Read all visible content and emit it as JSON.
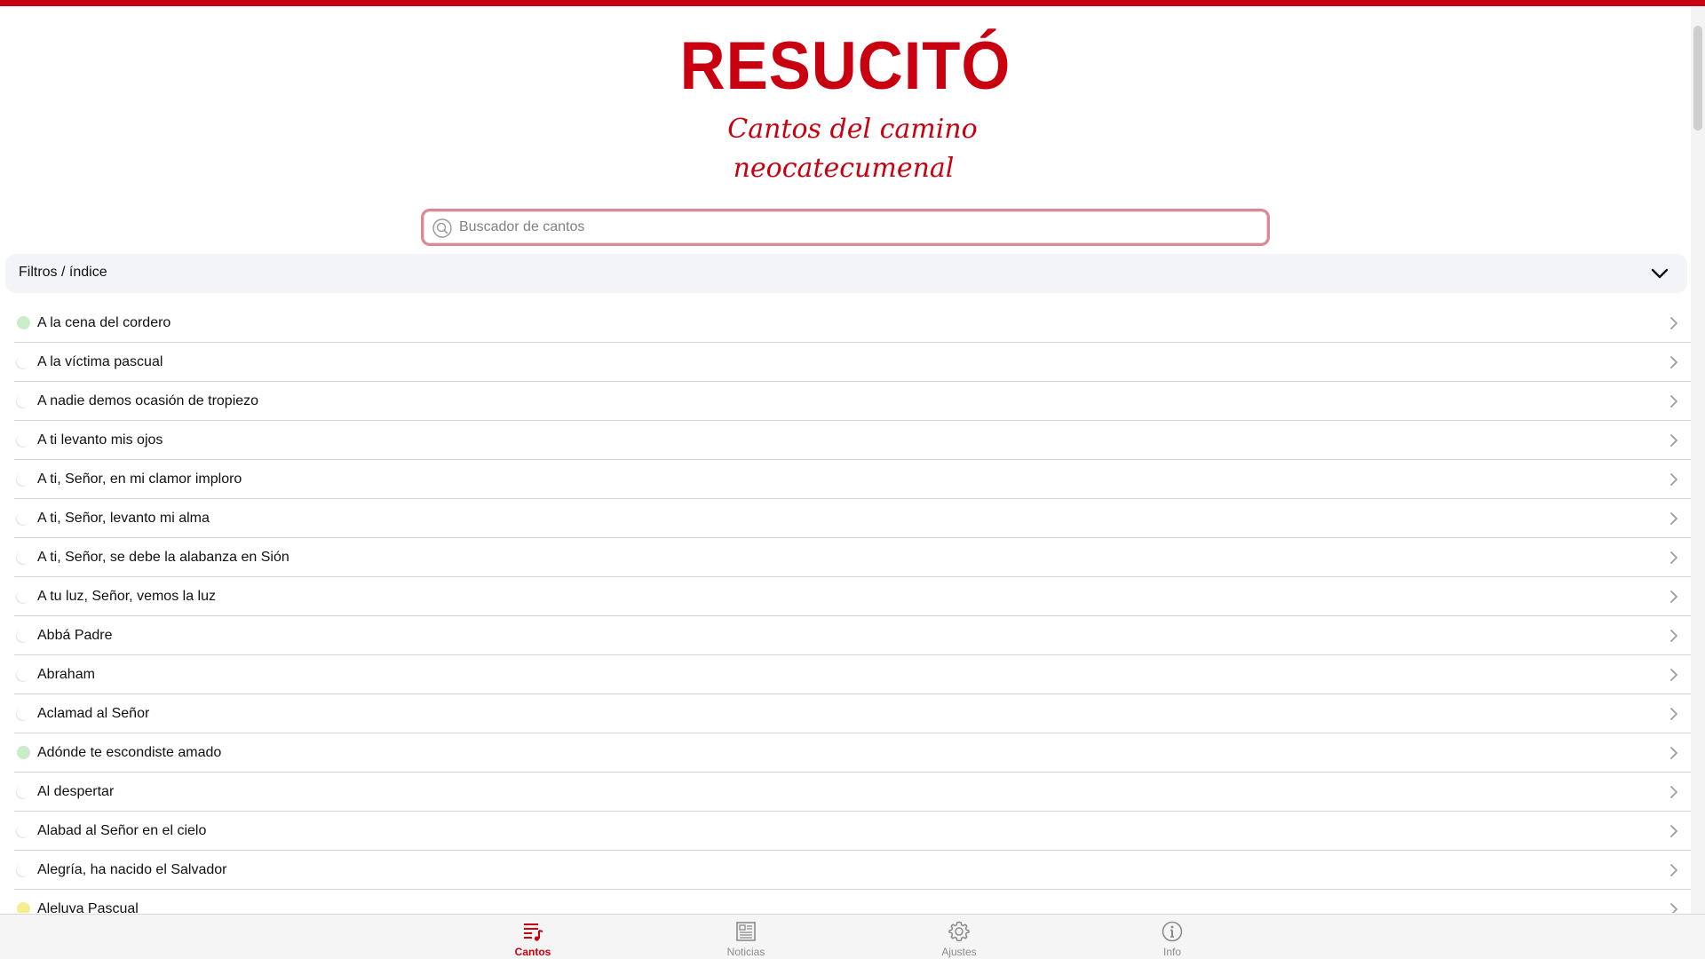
{
  "brand": {
    "title": "RESUCITÓ",
    "subtitle_line1": "Cantos del camino",
    "subtitle_line2": "neocatecumenal",
    "accent_color": "#c8000f"
  },
  "search": {
    "placeholder": "Buscador de cantos",
    "value": "",
    "icon": "search-icon"
  },
  "filters": {
    "label": "Filtros / índice",
    "icon": "chevron-down-icon"
  },
  "songs": [
    {
      "title": "A la cena del cordero",
      "marker": "green"
    },
    {
      "title": "A la víctima pascual",
      "marker": "none"
    },
    {
      "title": "A nadie demos ocasión de tropiezo",
      "marker": "none"
    },
    {
      "title": "A ti levanto mis ojos",
      "marker": "none"
    },
    {
      "title": "A ti, Señor, en mi clamor imploro",
      "marker": "none"
    },
    {
      "title": "A ti, Señor, levanto mi alma",
      "marker": "none"
    },
    {
      "title": "A ti, Señor, se debe la alabanza en Sión",
      "marker": "none"
    },
    {
      "title": "A tu luz, Señor, vemos la luz",
      "marker": "none"
    },
    {
      "title": "Abbá Padre",
      "marker": "none"
    },
    {
      "title": "Abraham",
      "marker": "none"
    },
    {
      "title": "Aclamad al Señor",
      "marker": "none"
    },
    {
      "title": "Adónde te escondiste amado",
      "marker": "green"
    },
    {
      "title": "Al despertar",
      "marker": "none"
    },
    {
      "title": "Alabad al Señor en el cielo",
      "marker": "none"
    },
    {
      "title": "Alegría, ha nacido el Salvador",
      "marker": "none"
    },
    {
      "title": "Aleluya Pascual",
      "marker": "yellow"
    }
  ],
  "marker_colors": {
    "green": "#c8edc7",
    "yellow": "#f6ed8f"
  },
  "tabs": [
    {
      "label": "Cantos",
      "icon": "music-list-icon",
      "active": true
    },
    {
      "label": "Noticias",
      "icon": "newspaper-icon",
      "active": false
    },
    {
      "label": "Ajustes",
      "icon": "gear-icon",
      "active": false
    },
    {
      "label": "Info",
      "icon": "info-icon",
      "active": false
    }
  ]
}
